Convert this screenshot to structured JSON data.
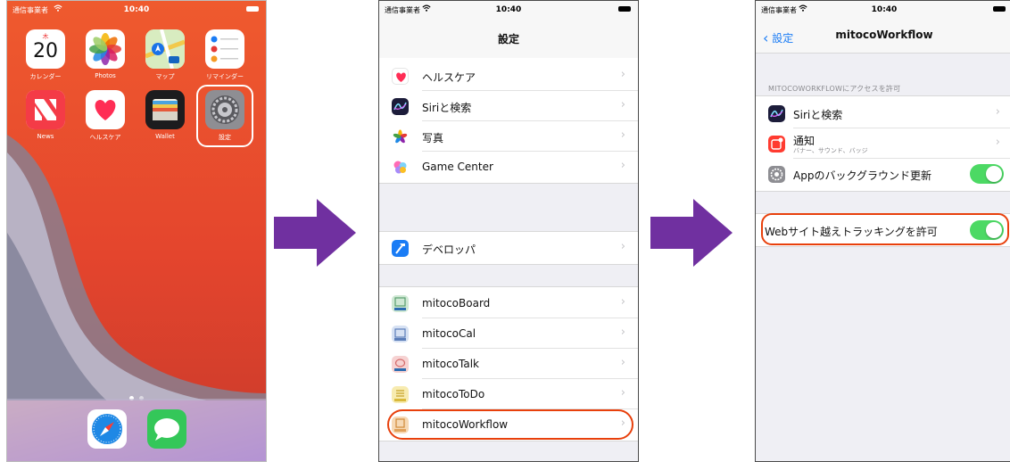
{
  "status_bar": {
    "carrier": "通信事業者",
    "time": "10:40"
  },
  "home": {
    "calendar": {
      "weekday": "木",
      "day": "20"
    },
    "apps_row1": [
      {
        "icon": "calendar-icon",
        "label": "カレンダー"
      },
      {
        "icon": "photos-icon",
        "label": "Photos"
      },
      {
        "icon": "maps-icon",
        "label": "マップ"
      },
      {
        "icon": "reminders-icon",
        "label": "リマインダー"
      }
    ],
    "apps_row2": [
      {
        "icon": "news-icon",
        "label": "News"
      },
      {
        "icon": "health-icon",
        "label": "ヘルスケア"
      },
      {
        "icon": "wallet-icon",
        "label": "Wallet"
      },
      {
        "icon": "settings-icon",
        "label": "設定"
      }
    ],
    "dock": [
      {
        "icon": "safari-icon"
      },
      {
        "icon": "messages-icon"
      }
    ],
    "colors": {
      "wallpaper_top": "#e9562f",
      "wallpaper_bottom": "#b37ad8"
    }
  },
  "settings": {
    "title": "設定",
    "group1": [
      {
        "icon": "health-icon",
        "label": "ヘルスケア"
      },
      {
        "icon": "siri-icon",
        "label": "Siriと検索"
      },
      {
        "icon": "photos-icon",
        "label": "写真"
      },
      {
        "icon": "game-center-icon",
        "label": "Game Center"
      }
    ],
    "group2": [
      {
        "icon": "developer-icon",
        "label": "デベロッパ"
      }
    ],
    "group3": [
      {
        "icon": "mitoco-board-icon",
        "label": "mitocoBoard"
      },
      {
        "icon": "mitoco-cal-icon",
        "label": "mitocoCal"
      },
      {
        "icon": "mitoco-talk-icon",
        "label": "mitocoTalk"
      },
      {
        "icon": "mitoco-todo-icon",
        "label": "mitocoToDo"
      },
      {
        "icon": "mitoco-workflow-icon",
        "label": "mitocoWorkflow"
      }
    ]
  },
  "app_settings": {
    "back_label": "設定",
    "title": "mitocoWorkflow",
    "section_header": "MITOCOWORKFLOWにアクセスを許可",
    "rows": [
      {
        "icon": "siri-icon",
        "label": "Siriと検索"
      },
      {
        "icon": "notification-icon",
        "label": "通知",
        "sublabel": "バナー、サウンド、バッジ"
      },
      {
        "icon": "gear-icon",
        "label": "Appのバックグラウンド更新",
        "toggle": true
      }
    ],
    "tracking": {
      "label": "Webサイト越えトラッキングを許可",
      "toggle": true
    }
  },
  "colors": {
    "arrow": "#7030a0",
    "highlight": "#e8400c",
    "toggle_on": "#4cd964",
    "link": "#1a7cf5"
  }
}
